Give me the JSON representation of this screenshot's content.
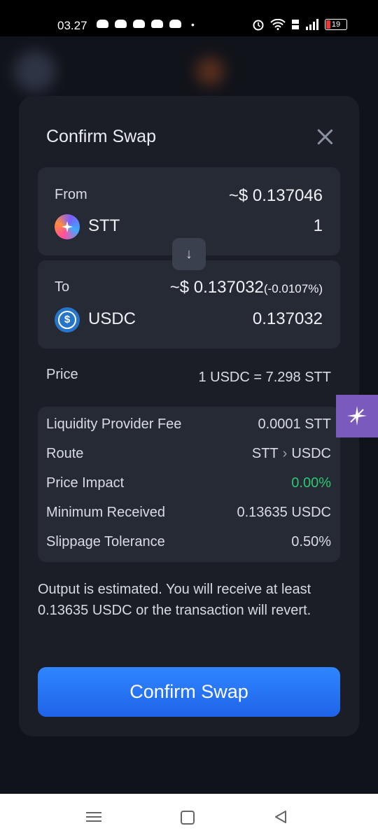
{
  "status_bar": {
    "time": "03.27",
    "dot": "•",
    "battery": "19"
  },
  "modal": {
    "title": "Confirm Swap",
    "from": {
      "label": "From",
      "usd": "~$ 0.137046",
      "token": "STT",
      "amount": "1"
    },
    "to": {
      "label": "To",
      "usd": "~$ 0.137032",
      "usd_diff": "(-0.0107%)",
      "token": "USDC",
      "amount": "0.137032"
    },
    "swap_arrow": "↓",
    "price": {
      "label": "Price",
      "value": "1 USDC = 7.298 STT"
    },
    "details": {
      "lp_fee": {
        "label": "Liquidity Provider Fee",
        "value": "0.0001 STT"
      },
      "route": {
        "label": "Route",
        "from": "STT",
        "sep": "›",
        "to": "USDC"
      },
      "price_impact": {
        "label": "Price Impact",
        "value": "0.00%"
      },
      "minimum_received": {
        "label": "Minimum Received",
        "value": "0.13635 USDC"
      },
      "slippage": {
        "label": "Slippage Tolerance",
        "value": "0.50%"
      }
    },
    "note": "Output is estimated. You will receive at least 0.13635 USDC or the transaction will revert.",
    "confirm_button": "Confirm Swap"
  },
  "colors": {
    "accent": "#2f86ff",
    "positive": "#2cc872",
    "side_tab": "#7a5bbd"
  },
  "icons": {
    "close": "close-icon",
    "arrow": "arrow-down-icon",
    "side_tab": "sparkle-icon"
  }
}
